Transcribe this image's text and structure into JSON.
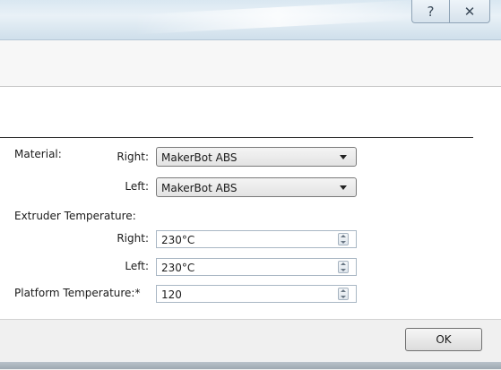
{
  "caption_buttons": {
    "help": "?",
    "close": "✕"
  },
  "material": {
    "label": "Material:",
    "right_label": "Right:",
    "right_value": "MakerBot ABS",
    "left_label": "Left:",
    "left_value": "MakerBot ABS"
  },
  "extruder": {
    "label": "Extruder Temperature:",
    "right_label": "Right:",
    "right_value": "230°C",
    "left_label": "Left:",
    "left_value": "230°C"
  },
  "platform": {
    "label": "Platform Temperature:*",
    "value": "120"
  },
  "footer": {
    "ok_label": "OK"
  }
}
